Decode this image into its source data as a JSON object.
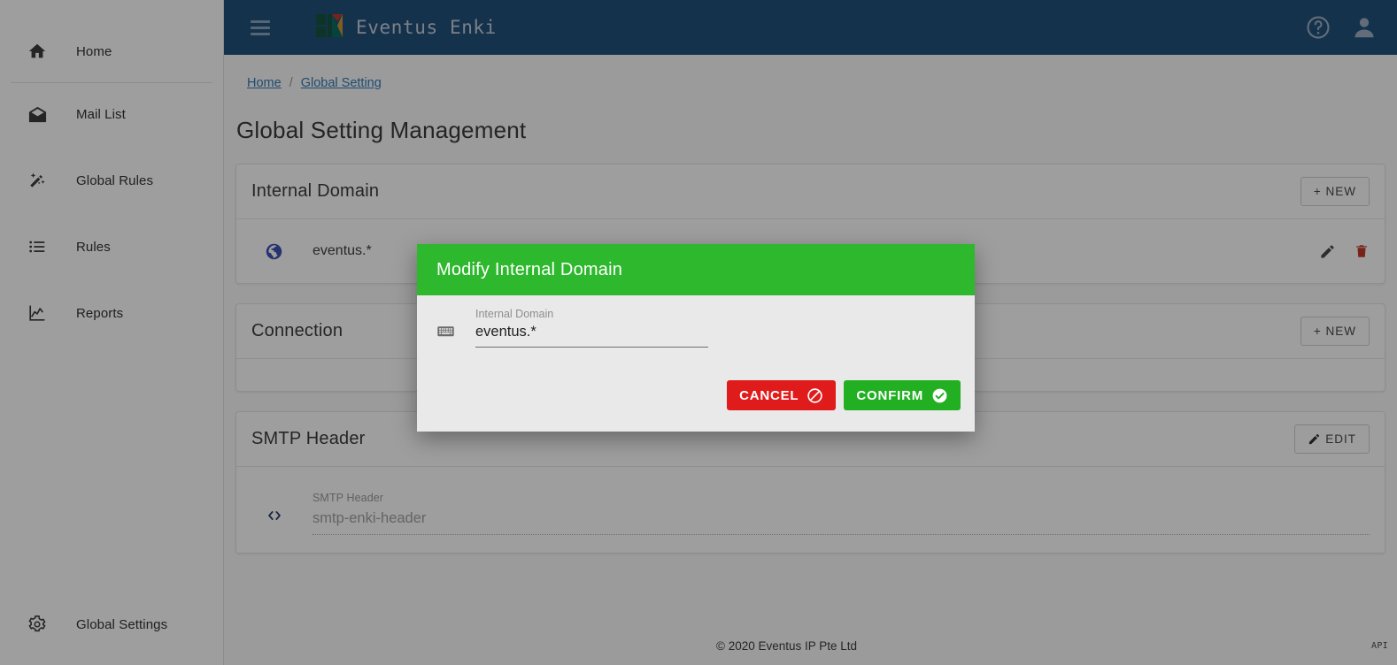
{
  "colors": {
    "topbar_blue": "#23527c",
    "modal_green": "#2eb82e",
    "cancel_red": "#e01b1b",
    "confirm_green": "#22b022",
    "link_blue": "#337ab7",
    "delete_red": "#c0392b"
  },
  "topbar": {
    "menu_icon": "hamburger-icon",
    "brand_title": "Eventus Enki",
    "logo_icon": "eventus-enki-logo",
    "help_icon": "help-circle-icon",
    "account_icon": "user-account-icon"
  },
  "sidebar": {
    "items": [
      {
        "label": "Home",
        "icon": "home-icon"
      },
      {
        "label": "Mail List",
        "icon": "mail-open-icon"
      },
      {
        "label": "Global Rules",
        "icon": "magic-wand-icon"
      },
      {
        "label": "Rules",
        "icon": "list-icon"
      },
      {
        "label": "Reports",
        "icon": "chart-line-icon"
      },
      {
        "label": "Global Settings",
        "icon": "gear-icon"
      }
    ]
  },
  "breadcrumb": {
    "home": "Home",
    "separator": "/",
    "current": "Global Setting"
  },
  "page": {
    "title": "Global Setting Management"
  },
  "cards": {
    "internal_domain": {
      "title": "Internal Domain",
      "new_button": "+ NEW",
      "row": {
        "icon": "globe-icon",
        "value": "eventus.*",
        "edit_icon": "pencil-icon",
        "delete_icon": "trash-icon"
      }
    },
    "connection": {
      "title": "Connection",
      "new_button": "+ NEW"
    },
    "smtp_header": {
      "title": "SMTP Header",
      "edit_button": "EDIT",
      "edit_icon": "pencil-icon",
      "field": {
        "icon": "code-brackets-icon",
        "label": "SMTP Header",
        "value": "smtp-enki-header"
      }
    }
  },
  "footer": {
    "copyright": "© 2020 Eventus IP Pte Ltd",
    "api_label": "API"
  },
  "modal": {
    "title": "Modify Internal Domain",
    "field": {
      "icon": "keyboard-icon",
      "label": "Internal Domain",
      "value": "eventus.*",
      "placeholder": "Internal Domain"
    },
    "cancel_label": "CANCEL",
    "cancel_icon": "ban-circle-icon",
    "confirm_label": "CONFIRM",
    "confirm_icon": "check-circle-icon"
  }
}
